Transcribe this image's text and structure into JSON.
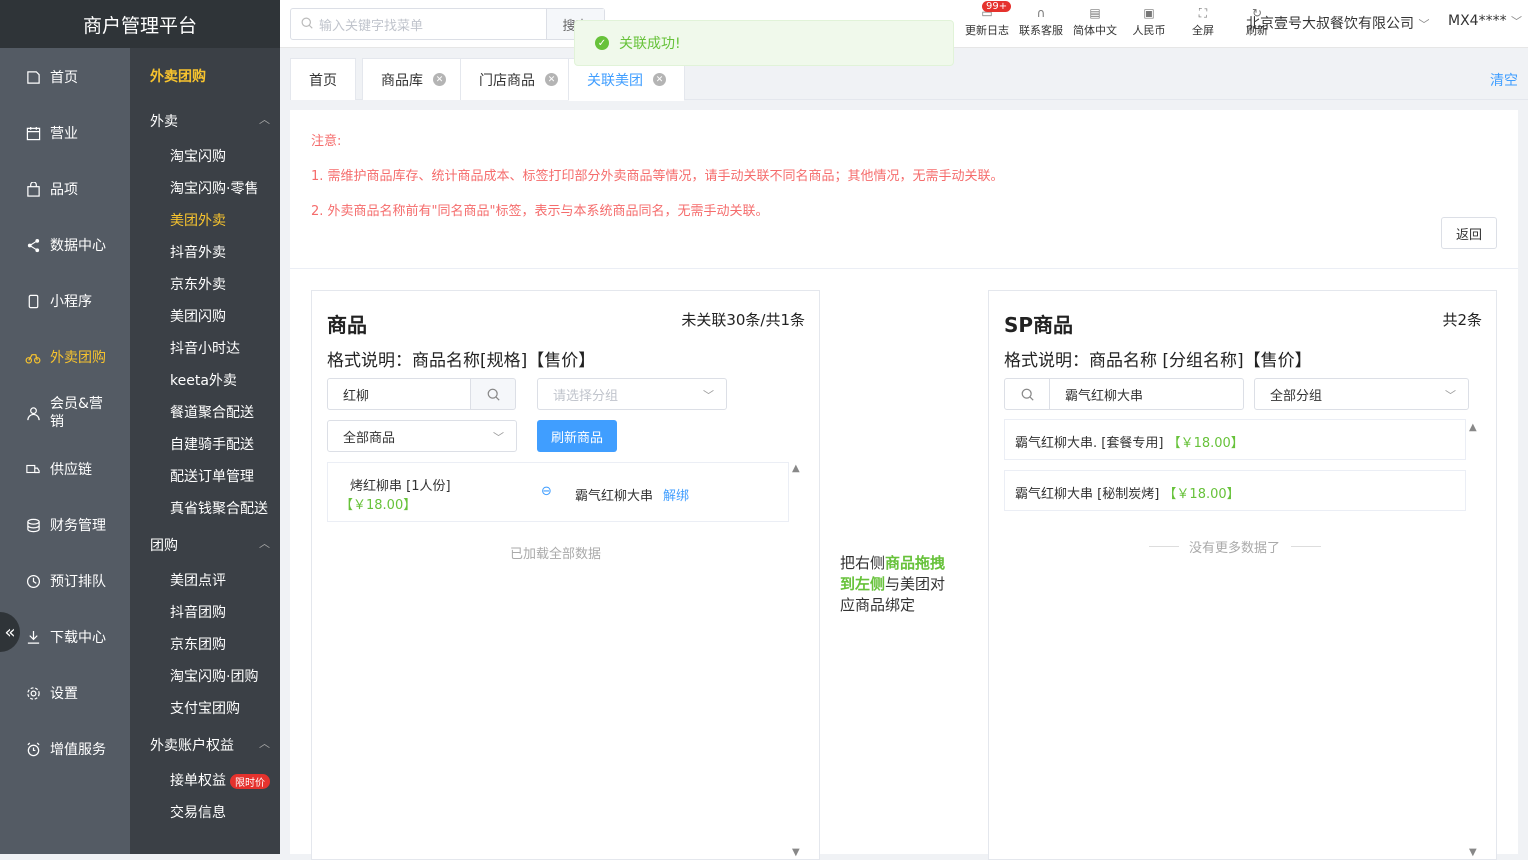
{
  "sidebar": {
    "brand": "商户管理平台",
    "items": [
      {
        "label": "首页",
        "icon": "home-icon"
      },
      {
        "label": "营业",
        "icon": "calendar-icon"
      },
      {
        "label": "品项",
        "icon": "bag-icon"
      },
      {
        "label": "数据中心",
        "icon": "share-icon"
      },
      {
        "label": "小程序",
        "icon": "phone-icon"
      },
      {
        "label": "外卖团购",
        "icon": "bike-icon"
      },
      {
        "label": "会员&营销",
        "icon": "user-icon"
      },
      {
        "label": "供应链",
        "icon": "truck-icon"
      },
      {
        "label": "财务管理",
        "icon": "database-icon"
      },
      {
        "label": "预订排队",
        "icon": "clock-icon"
      },
      {
        "label": "下载中心",
        "icon": "download-icon"
      },
      {
        "label": "设置",
        "icon": "gear-icon"
      },
      {
        "label": "增值服务",
        "icon": "alarm-icon"
      }
    ]
  },
  "submenu": {
    "heading": "外卖团购",
    "groups": [
      {
        "label": "外卖",
        "items": [
          "淘宝闪购",
          "淘宝闪购·零售",
          "美团外卖",
          "抖音外卖",
          "京东外卖",
          "美团闪购",
          "抖音小时达",
          "keeta外卖",
          "餐道聚合配送",
          "自建骑手配送",
          "配送订单管理",
          "真省钱聚合配送"
        ]
      },
      {
        "label": "团购",
        "items": [
          "美团点评",
          "抖音团购",
          "京东团购",
          "淘宝闪购·团购",
          "支付宝团购"
        ]
      },
      {
        "label": "外卖账户权益",
        "items": [
          "接单权益",
          "交易信息"
        ]
      }
    ],
    "limited_tag": "限时价"
  },
  "topbar": {
    "search_placeholder": "输入关键字找菜单",
    "search_button": "搜索",
    "tools": [
      "更新日志",
      "联系客服",
      "简体中文",
      "人民币",
      "全屏",
      "刷新"
    ],
    "update_badge": "99+",
    "company": "北京壹号大叔餐饮有限公司",
    "user": "MX4****"
  },
  "toast": {
    "message": "关联成功!"
  },
  "tabs": {
    "items": [
      "首页",
      "商品库",
      "门店商品",
      "关联美团"
    ],
    "clear": "清空"
  },
  "notice": {
    "title": "注意:",
    "line1": "1. 需维护商品库存、统计商品成本、标签打印部分外卖商品等情况，请手动关联不同名商品；其他情况，无需手动关联。",
    "line2": "2. 外卖商品名称前有\"同名商品\"标签，表示与本系统商品同名，无需手动关联。",
    "back": "返回"
  },
  "left_panel": {
    "title": "商品",
    "count": "未关联30条/共1条",
    "format": "格式说明：商品名称[规格]【售价】",
    "search_value": "红柳",
    "group_placeholder": "请选择分组",
    "filter": "全部商品",
    "refresh": "刷新商品",
    "row": {
      "name": "烤红柳串 [1人份]",
      "price": "【￥18.00】",
      "linked": "霸气红柳大串",
      "unbind": "解绑"
    },
    "footer": "已加载全部数据"
  },
  "hint": {
    "p1": "把右侧",
    "b1": "商品拖拽到左侧",
    "p2": "与美团对应商品绑定"
  },
  "right_panel": {
    "title": "SP商品",
    "count": "共2条",
    "format": "格式说明：商品名称 [分组名称]【售价】",
    "search_value": "霸气红柳大串",
    "group": "全部分组",
    "rows": [
      {
        "name": "霸气红柳大串. [套餐专用]",
        "price": "【￥18.00】"
      },
      {
        "name": "霸气红柳大串 [秘制炭烤]",
        "price": "【￥18.00】"
      }
    ],
    "footer": "没有更多数据了"
  }
}
